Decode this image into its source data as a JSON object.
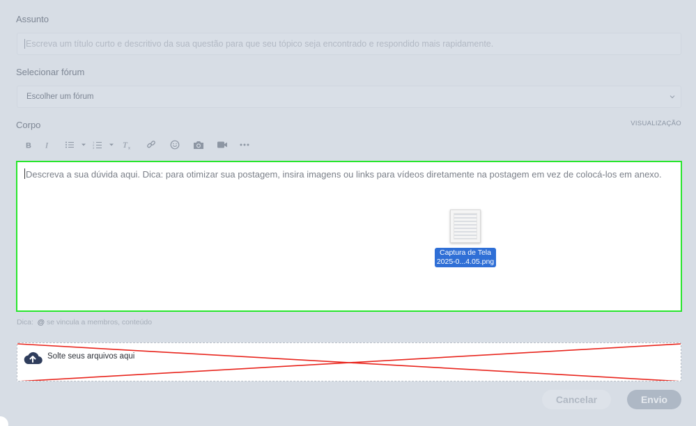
{
  "subject": {
    "label": "Assunto",
    "placeholder": "Escreva um título curto e descritivo da sua questão para que seu tópico seja encontrado e respondido mais rapidamente."
  },
  "forum": {
    "label": "Selecionar fórum",
    "selected": "Escolher um fórum"
  },
  "body": {
    "label": "Corpo",
    "preview_link": "VISUALIZAÇÃO",
    "placeholder": "Descreva a sua dúvida aqui. Dica: para otimizar sua postagem, insira imagens ou links para vídeos diretamente na postagem em vez de colocá-los em anexo."
  },
  "toolbar": {
    "icons": [
      "bold-icon",
      "italic-icon",
      "bullet-list-icon",
      "numbered-list-icon",
      "clear-format-icon",
      "link-icon",
      "emoji-icon",
      "camera-icon",
      "video-icon",
      "more-icon"
    ]
  },
  "dragged_file": {
    "name_line1": "Captura de Tela",
    "name_line2": "2025-0...4.05.png"
  },
  "hint": {
    "prefix": "Dica:",
    "symbol": "@",
    "text": "se vincula a membros, conteúdo"
  },
  "dropzone": {
    "label": "Solte seus arquivos aqui"
  },
  "actions": {
    "cancel": "Cancelar",
    "submit": "Envio"
  },
  "colors": {
    "background": "#d7dde5",
    "editor_highlight": "#27e62c",
    "dropzone_cross": "#e8231b",
    "file_label_bg": "#2f6fd6"
  }
}
